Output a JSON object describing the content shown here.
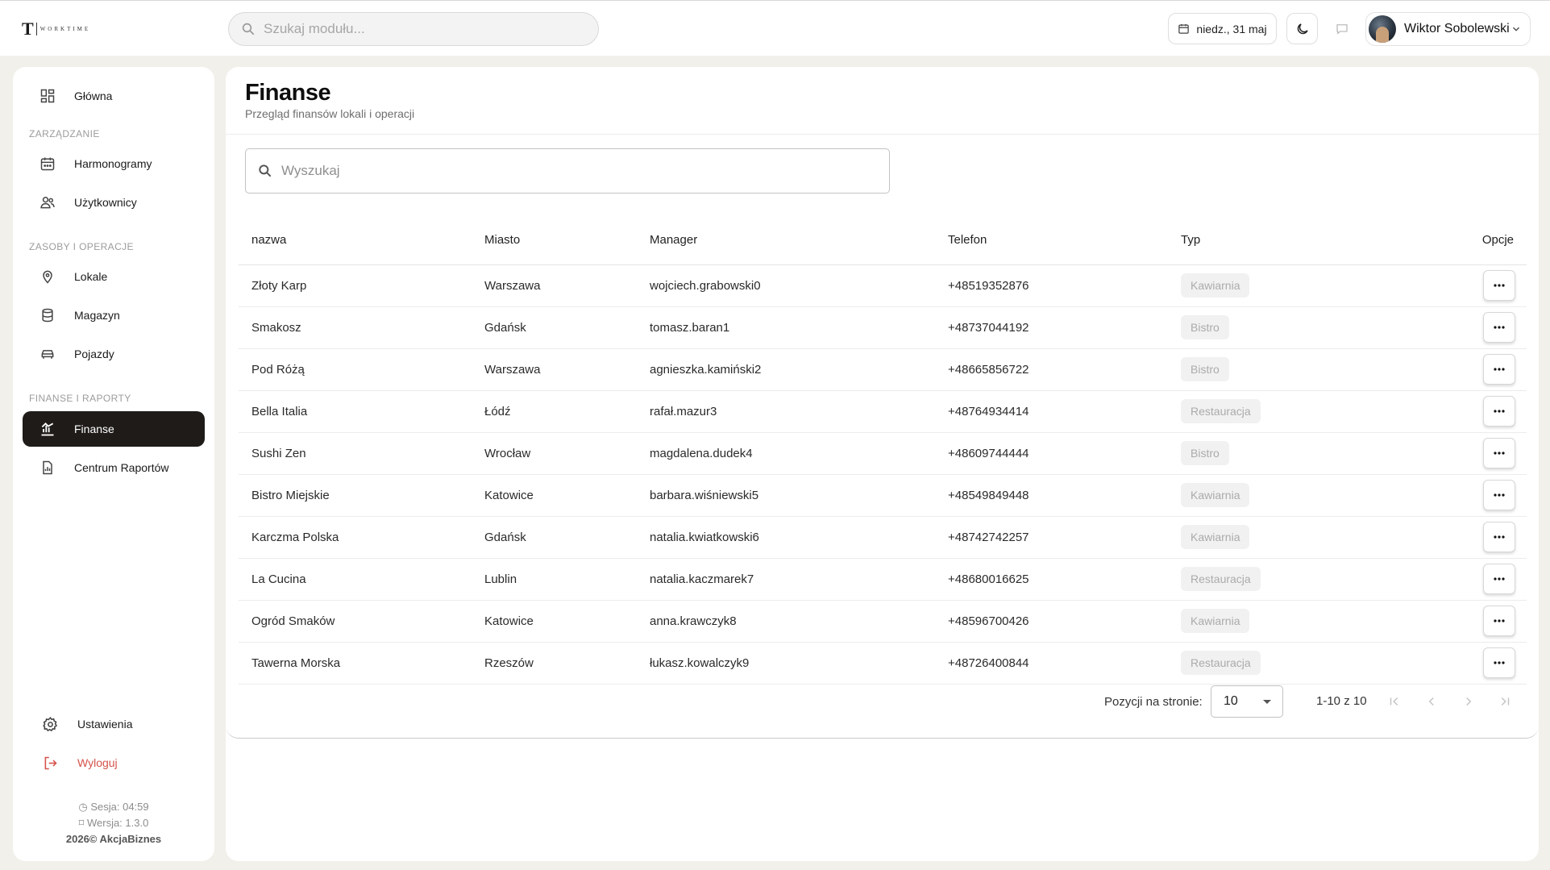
{
  "app": {
    "logo_letter": "T",
    "logo_word": "WORKTIME"
  },
  "topbar": {
    "search_placeholder": "Szukaj modułu...",
    "date": "niedz., 31 maj",
    "user_name": "Wiktor Sobolewski"
  },
  "sidebar": {
    "home": "Główna",
    "section_management": "ZARZĄDZANIE",
    "schedules": "Harmonogramy",
    "users": "Użytkownicy",
    "section_resources": "ZASOBY I OPERACJE",
    "locations": "Lokale",
    "warehouse": "Magazyn",
    "vehicles": "Pojazdy",
    "section_finance": "FINANSE I RAPORTY",
    "finance": "Finanse",
    "reports": "Centrum Raportów",
    "settings": "Ustawienia",
    "logout": "Wyloguj",
    "session": "Sesja: 04:59",
    "version": "Wersja: 1.3.0",
    "copyright": "2026© AkcjaBiznes"
  },
  "page": {
    "title": "Finanse",
    "subtitle": "Przegląd finansów lokali i operacji",
    "search_placeholder": "Wyszukaj"
  },
  "table": {
    "columns": [
      "nazwa",
      "Miasto",
      "Manager",
      "Telefon",
      "Typ",
      "Opcje"
    ],
    "rows": [
      {
        "name": "Złoty Karp",
        "city": "Warszawa",
        "manager": "wojciech.grabowski0",
        "phone": "+48519352876",
        "type": "Kawiarnia"
      },
      {
        "name": "Smakosz",
        "city": "Gdańsk",
        "manager": "tomasz.baran1",
        "phone": "+48737044192",
        "type": "Bistro"
      },
      {
        "name": "Pod Różą",
        "city": "Warszawa",
        "manager": "agnieszka.kamiński2",
        "phone": "+48665856722",
        "type": "Bistro"
      },
      {
        "name": "Bella Italia",
        "city": "Łódź",
        "manager": "rafał.mazur3",
        "phone": "+48764934414",
        "type": "Restauracja"
      },
      {
        "name": "Sushi Zen",
        "city": "Wrocław",
        "manager": "magdalena.dudek4",
        "phone": "+48609744444",
        "type": "Bistro"
      },
      {
        "name": "Bistro Miejskie",
        "city": "Katowice",
        "manager": "barbara.wiśniewski5",
        "phone": "+48549849448",
        "type": "Kawiarnia"
      },
      {
        "name": "Karczma Polska",
        "city": "Gdańsk",
        "manager": "natalia.kwiatkowski6",
        "phone": "+48742742257",
        "type": "Kawiarnia"
      },
      {
        "name": "La Cucina",
        "city": "Lublin",
        "manager": "natalia.kaczmarek7",
        "phone": "+48680016625",
        "type": "Restauracja"
      },
      {
        "name": "Ogród Smaków",
        "city": "Katowice",
        "manager": "anna.krawczyk8",
        "phone": "+48596700426",
        "type": "Kawiarnia"
      },
      {
        "name": "Tawerna Morska",
        "city": "Rzeszów",
        "manager": "łukasz.kowalczyk9",
        "phone": "+48726400844",
        "type": "Restauracja"
      }
    ]
  },
  "pagination": {
    "per_page_label": "Pozycji na stronie:",
    "per_page_value": "10",
    "range": "1-10 z 10"
  },
  "colors": {
    "background": "#f2f0ea",
    "active_nav": "#1e1b19",
    "logout": "#d6514a"
  }
}
